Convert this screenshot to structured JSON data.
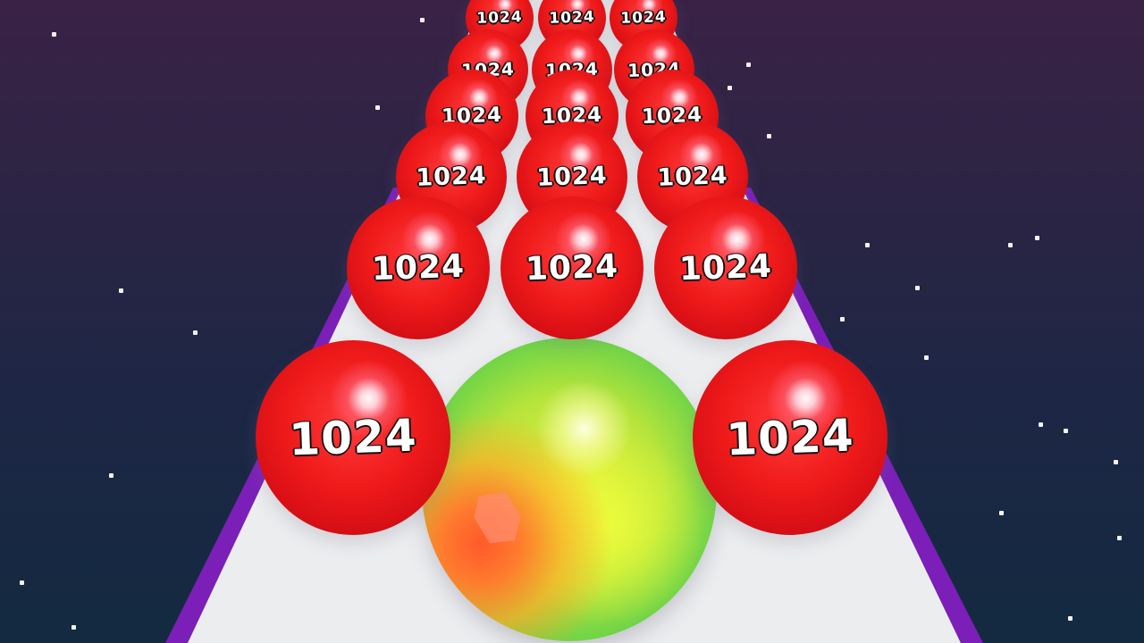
{
  "game": {
    "player_ball": {
      "colors": [
        "#ff5a2a",
        "#e8f03a",
        "#3fb443"
      ]
    },
    "ball_color": "#e51616",
    "track_colors": {
      "surface": "#ecedef",
      "rail": "#7b1fb8"
    },
    "rows": [
      {
        "labels": [
          "1024",
          "1024",
          "1024"
        ]
      },
      {
        "labels": [
          "1024",
          "1024",
          "1024"
        ]
      },
      {
        "labels": [
          "1024",
          "1024",
          "1024"
        ]
      },
      {
        "labels": [
          "1024",
          "1024",
          "1024"
        ]
      },
      {
        "labels": [
          "1024",
          "1024",
          "1024"
        ]
      },
      {
        "labels": [
          "1024",
          "1024",
          "1024"
        ]
      },
      {
        "labels": [
          "1024",
          "",
          "1024"
        ]
      }
    ]
  }
}
